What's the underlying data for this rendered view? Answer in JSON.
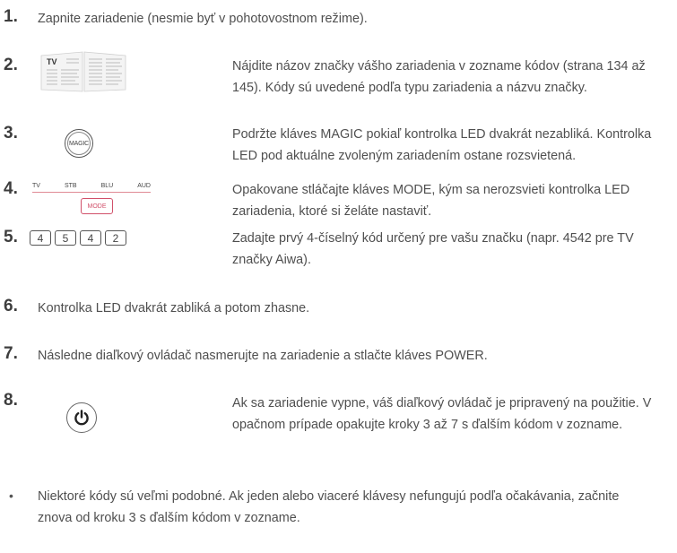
{
  "steps": [
    {
      "number": "1.",
      "text": "Zapnite zariadenie (nesmie byť v pohotovostnom režime)."
    },
    {
      "number": "2.",
      "text": "Nájdite názov značky vášho zariadenia v zozname kódov (strana 134 až 145). Kódy sú uvedené podľa typu zariadenia a názvu značky.",
      "illustration": {
        "label": "TV"
      }
    },
    {
      "number": "3.",
      "text": "Podržte kláves MAGIC pokiaľ kontrolka LED dvakrát nezabliká. Kontrolka LED pod aktuálne zvoleným zariadením ostane rozsvietená.",
      "illustration": {
        "button_label": "MAGIC"
      }
    },
    {
      "number": "4.",
      "text": "Opakovane stláčajte kláves MODE, kým sa nerozsvieti kontrolka LED zariadenia, ktoré si želáte nastaviť.",
      "illustration": {
        "devices": [
          "TV",
          "STB",
          "BLU",
          "AUD"
        ],
        "button_label": "MODE",
        "accent_color": "#d1506a"
      }
    },
    {
      "number": "5.",
      "text": "Zadajte prvý 4-číselný kód určený pre vašu značku (napr. 4542 pre TV značky Aiwa).",
      "illustration": {
        "keys": [
          "4",
          "5",
          "4",
          "2"
        ]
      }
    },
    {
      "number": "6.",
      "text": "Kontrolka LED dvakrát zabliká a potom zhasne."
    },
    {
      "number": "7.",
      "text": "Následne diaľkový ovládač nasmerujte na zariadenie a stlačte kláves POWER."
    },
    {
      "number": "8.",
      "text": "Ak sa zariadenie vypne, váš diaľkový ovládač je pripravený na použitie. V opačnom prípade opakujte kroky 3 až 7 s ďalším kódom v zozname.",
      "illustration": {
        "icon": "power-icon"
      }
    }
  ],
  "note": {
    "bullet": "•",
    "text": "Niektoré kódy sú veľmi podobné. Ak jeden alebo viaceré klávesy nefungujú podľa očakávania, začnite znova od kroku 3 s ďalším kódom v zozname."
  }
}
